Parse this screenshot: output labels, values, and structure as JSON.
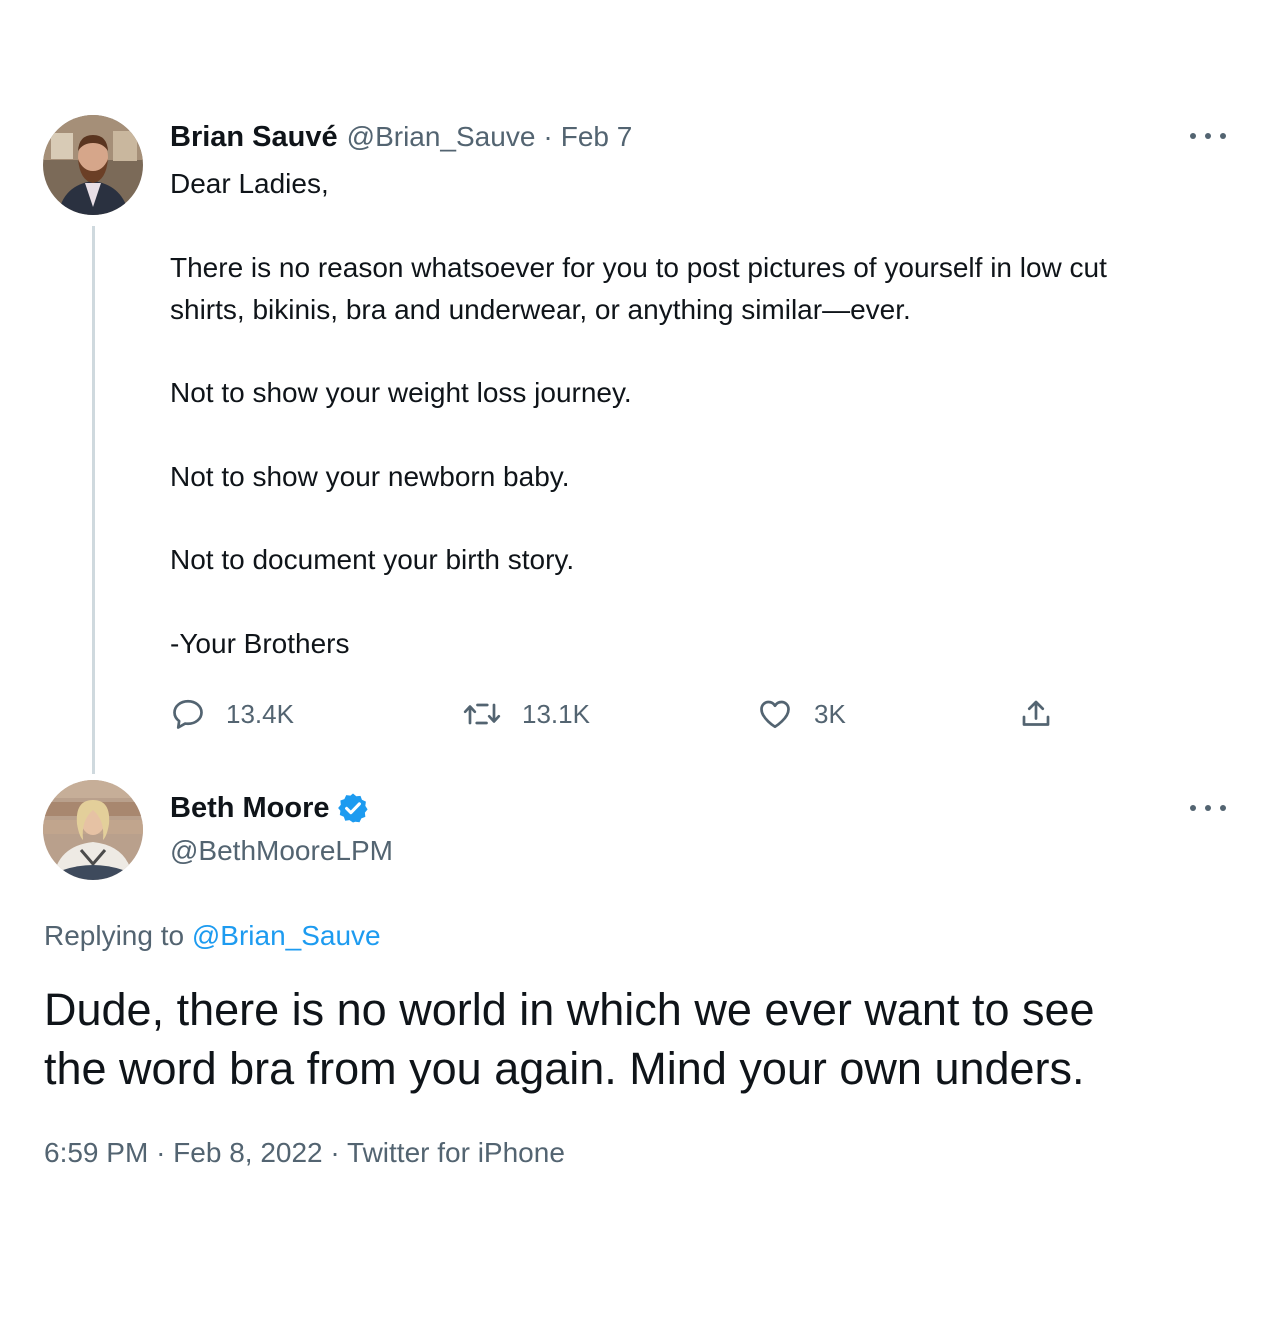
{
  "tweet": {
    "author_name": "Brian Sauvé",
    "author_handle": "@Brian_Sauve",
    "separator": "·",
    "date": "Feb 7",
    "more_icon": "more-dots-icon",
    "lines": [
      "Dear Ladies,",
      "There is no reason whatsoever for you to post pictures of yourself in low cut",
      "shirts, bikinis, bra and underwear, or anything similar—ever.",
      "Not to show your weight loss journey.",
      "Not to show your newborn baby.",
      "Not to document your birth story.",
      "-Your Brothers"
    ],
    "actions": {
      "replies": "13.4K",
      "retweets": "13.1K",
      "likes": "3K"
    }
  },
  "reply": {
    "author_name": "Beth Moore",
    "verified": true,
    "author_handle": "@BethMooreLPM",
    "replying_to_prefix": "Replying to",
    "replying_to_handle": "@Brian_Sauve",
    "lines": [
      "Dude, there is no world in which we ever want to see",
      "the word bra from you again. Mind your own unders."
    ],
    "time": "6:59 PM",
    "separator": "·",
    "date": "Feb 8, 2022",
    "source": "Twitter for iPhone"
  },
  "colors": {
    "text": "#0f1419",
    "muted": "#536471",
    "link": "#1d9bf0",
    "verified": "#1d9bf0",
    "thread_line": "#cfd9de"
  }
}
